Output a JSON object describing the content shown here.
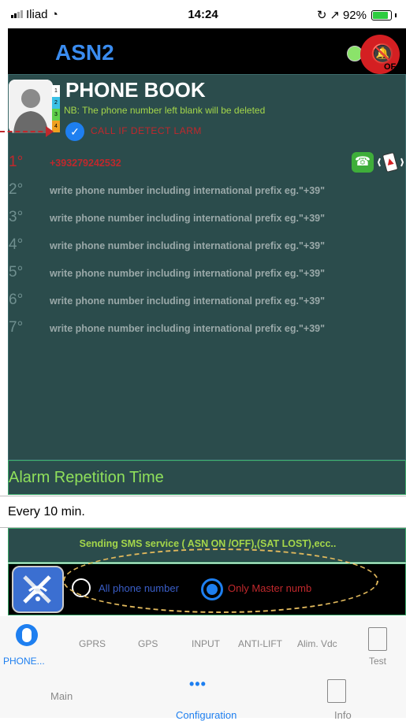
{
  "status_bar": {
    "carrier": "Iliad",
    "time": "14:24",
    "battery": "92%"
  },
  "app": {
    "title": "ASN2",
    "alarm_badge": "OF"
  },
  "phone_book": {
    "title": "PHONE BOOK",
    "note": "NB: The phone number left blank will be deleted",
    "call_if_detect_label": "CALL IF DETECT LARM",
    "tab_strip": [
      "1",
      "2",
      "3",
      "4"
    ],
    "rows": [
      {
        "num": "1°",
        "text": "+393279242532"
      },
      {
        "num": "2°",
        "text": "write phone number including  international prefix eg.\"+39\""
      },
      {
        "num": "3°",
        "text": "write phone number including  international prefix eg.\"+39\""
      },
      {
        "num": "4°",
        "text": "write phone number including  international prefix eg.\"+39\""
      },
      {
        "num": "5°",
        "text": "write phone number including  international prefix eg.\"+39\""
      },
      {
        "num": "6°",
        "text": "write phone number including  international prefix eg.\"+39\""
      },
      {
        "num": "7°",
        "text": "write phone number including  international prefix eg.\"+39\""
      }
    ]
  },
  "repetition": {
    "label": "Alarm Repetition Time",
    "value": "Every 10 min."
  },
  "sms": {
    "label": "Sending SMS service ( ASN ON /OFF),(SAT LOST),ecc.."
  },
  "recipients": {
    "all_label": "All phone number",
    "master_label": "Only Master numb",
    "selected": "master"
  },
  "tabbar_top": {
    "items": [
      {
        "label": "PHONE..."
      },
      {
        "label": "GPRS"
      },
      {
        "label": "GPS"
      },
      {
        "label": "INPUT"
      },
      {
        "label": "ANTI-LIFT"
      },
      {
        "label": "Alim. Vdc"
      },
      {
        "label": "Test"
      }
    ]
  },
  "tabbar_bottom": {
    "items": [
      {
        "label": "Main"
      },
      {
        "label": "Configuration"
      },
      {
        "label": "Info"
      }
    ]
  },
  "colors": {
    "panel_bg": "#2b4c4c",
    "accent_blue": "#1e7ff0",
    "alert_red": "#c0282c",
    "lime": "#a4d64a"
  }
}
